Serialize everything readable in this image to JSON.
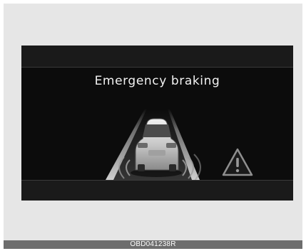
{
  "display": {
    "message": "Emergency braking",
    "icons": {
      "vehicle": "car-rear-icon",
      "warning": "warning-triangle-icon",
      "radar": "radar-waves-icon",
      "road": "lane-lines-icon"
    }
  },
  "caption": {
    "code": "OBD041238R"
  },
  "colors": {
    "panel_bg": "#e6e6e6",
    "display_bg": "#101010",
    "text": "#f2f2f2",
    "caption_bg": "#6d6d6d"
  }
}
